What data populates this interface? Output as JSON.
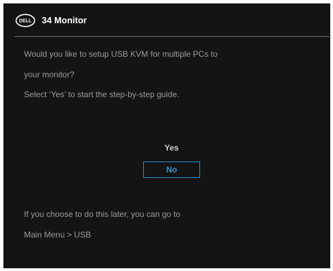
{
  "header": {
    "logo_text": "DELL",
    "title": "34 Monitor"
  },
  "message": {
    "line1": "Would you like to setup USB KVM for multiple PCs to",
    "line2": "your monitor?",
    "line3": "Select ‘Yes’ to start the step-by-step guide."
  },
  "options": {
    "yes": "Yes",
    "no": "No",
    "selected": "No"
  },
  "footer": {
    "line1": "If you choose to do this later, you can go to",
    "line2": "Main Menu > USB"
  },
  "colors": {
    "background": "#141414",
    "text": "#9b9b9b",
    "accent": "#2f93d4"
  }
}
